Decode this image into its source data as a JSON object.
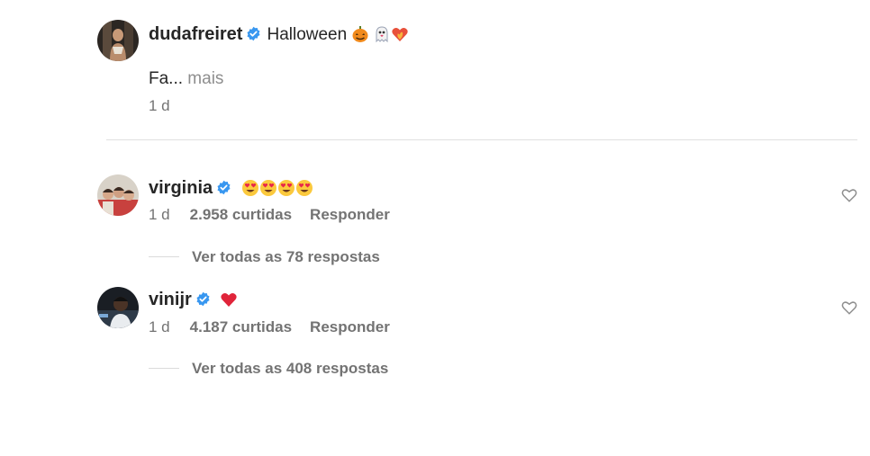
{
  "caption": {
    "username": "dudafreiret",
    "text": "Halloween",
    "emojis": [
      "jack-o-lantern",
      "ghost",
      "heart-on-fire"
    ],
    "body": "Fa...",
    "more_label": "mais",
    "time": "1 d"
  },
  "comments": [
    {
      "username": "virginia",
      "emojis": [
        "heart-eyes",
        "heart-eyes",
        "heart-eyes",
        "heart-eyes"
      ],
      "time": "1 d",
      "likes": "2.958 curtidas",
      "reply_label": "Responder",
      "view_replies": "Ver todas as 78 respostas"
    },
    {
      "username": "vinijr",
      "emojis": [
        "red-heart"
      ],
      "time": "1 d",
      "likes": "4.187 curtidas",
      "reply_label": "Responder",
      "view_replies": "Ver todas as 408 respostas"
    }
  ],
  "colors": {
    "verified": "#3897f0",
    "text": "#262626",
    "muted": "#737373",
    "divider": "#e0e0e0"
  }
}
